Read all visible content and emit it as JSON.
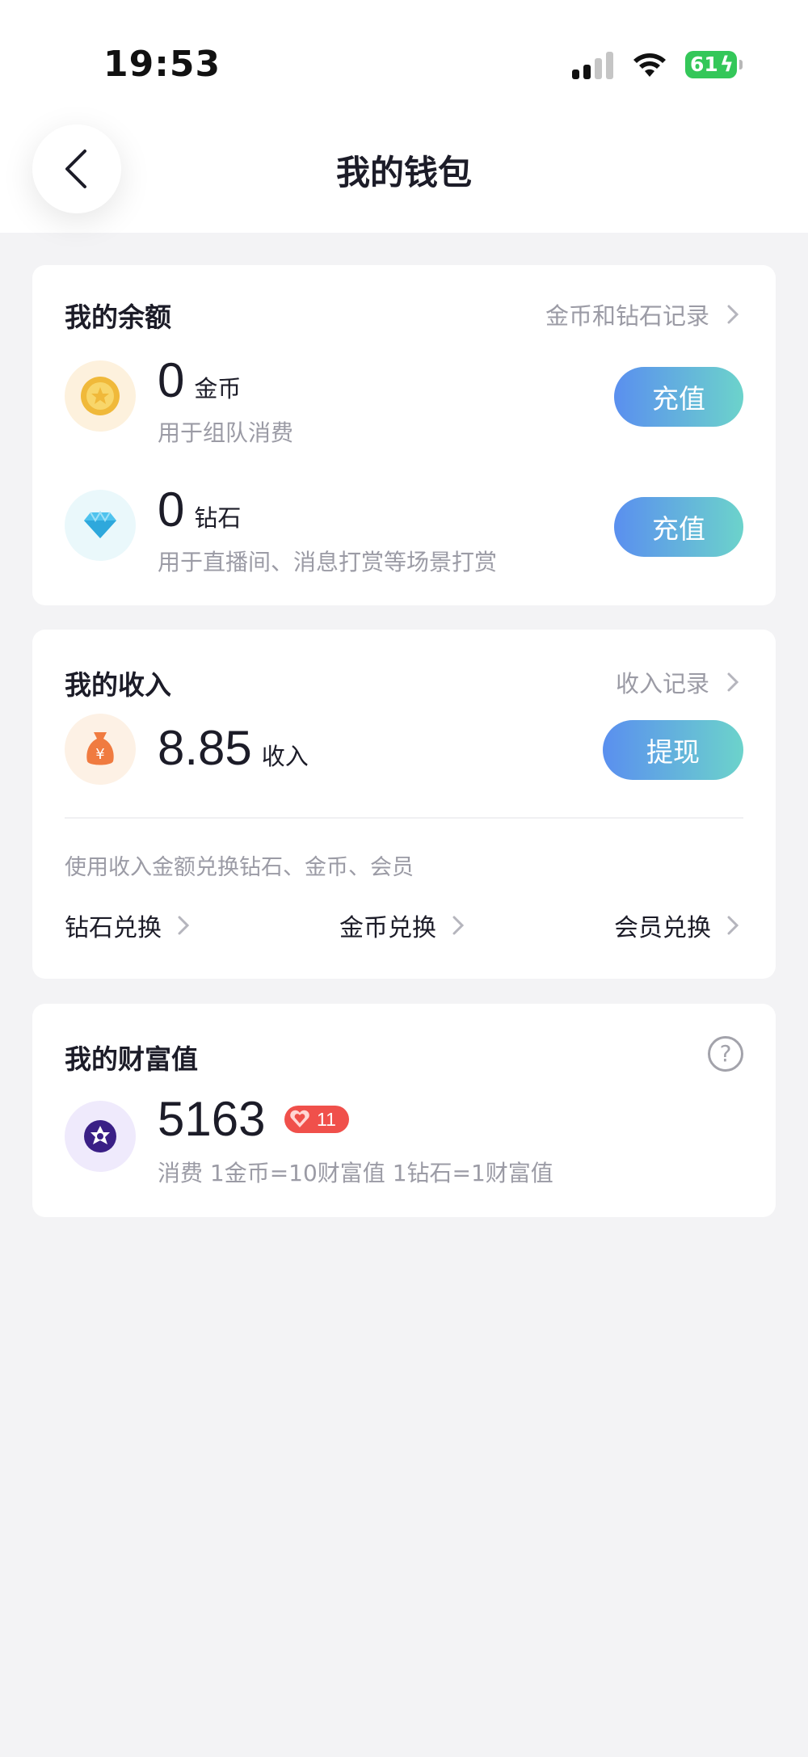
{
  "status_bar": {
    "time": "19:53",
    "battery": "61"
  },
  "header": {
    "title": "我的钱包"
  },
  "balance": {
    "title": "我的余额",
    "link": "金币和钻石记录",
    "coins": {
      "amount": "0",
      "unit": "金币",
      "desc": "用于组队消费",
      "button": "充值"
    },
    "diamonds": {
      "amount": "0",
      "unit": "钻石",
      "desc": "用于直播间、消息打赏等场景打赏",
      "button": "充值"
    }
  },
  "income": {
    "title": "我的收入",
    "link": "收入记录",
    "amount": "8.85",
    "unit": "收入",
    "button": "提现",
    "hint": "使用收入金额兑换钻石、金币、会员",
    "exchanges": [
      "钻石兑换",
      "金币兑换",
      "会员兑换"
    ]
  },
  "wealth": {
    "title": "我的财富值",
    "help": "?",
    "value": "5163",
    "level": "11",
    "desc": "消费 1金币=10财富值 1钻石=1财富值"
  },
  "colors": {
    "background": "#f3f3f5",
    "button_gradient_start": "#5a8fef",
    "button_gradient_end": "#6cd3cb",
    "badge": "#f0504b"
  }
}
